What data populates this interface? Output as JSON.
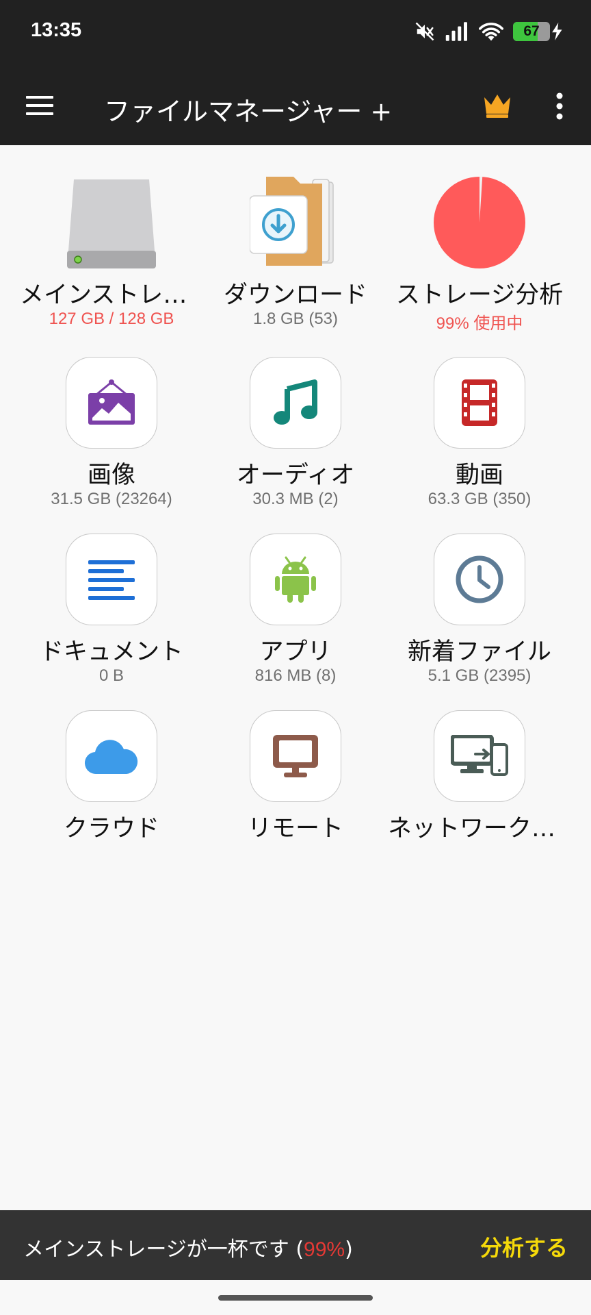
{
  "status_bar": {
    "time": "13:35",
    "battery_level": "67",
    "battery_fraction": 0.67,
    "icons": [
      "mute-icon",
      "signal-icon",
      "wifi-icon",
      "battery-icon",
      "charging-icon"
    ]
  },
  "app_bar": {
    "title": "ファイルマネージャー +",
    "icons": [
      "menu-icon",
      "crown-icon",
      "more-vert-icon"
    ]
  },
  "tiles": [
    {
      "label": "メインストレージ",
      "sub": "127 GB / 128 GB",
      "icon": "drive-icon",
      "sub_color": "#ef5350"
    },
    {
      "label": "ダウンロード",
      "sub": "1.8 GB (53)",
      "icon": "download-folder-icon"
    },
    {
      "label": "ストレージ分析",
      "sub": "99% 使用中",
      "icon": "pie-chart-icon",
      "sub_color": "#ef5350",
      "usage_fraction": 0.99
    },
    {
      "label": "画像",
      "sub": "31.5 GB (23264)",
      "icon": "image-icon"
    },
    {
      "label": "オーディオ",
      "sub": "30.3 MB (2)",
      "icon": "music-note-icon"
    },
    {
      "label": "動画",
      "sub": "63.3 GB (350)",
      "icon": "film-icon"
    },
    {
      "label": "ドキュメント",
      "sub": "0 B",
      "icon": "document-icon"
    },
    {
      "label": "アプリ",
      "sub": "816 MB (8)",
      "icon": "android-icon"
    },
    {
      "label": "新着ファイル",
      "sub": "5.1 GB (2395)",
      "icon": "clock-icon"
    },
    {
      "label": "クラウド",
      "sub": "",
      "icon": "cloud-icon"
    },
    {
      "label": "リモート",
      "sub": "",
      "icon": "monitor-icon"
    },
    {
      "label": "ネットワークから",
      "sub": "",
      "icon": "network-devices-icon"
    }
  ],
  "bottom_banner": {
    "message_prefix": "メインストレージが一杯です (",
    "percent": "99%",
    "message_suffix": ")",
    "action": "分析する"
  },
  "colors": {
    "bar_background": "#212121",
    "warning_red": "#ef5350",
    "action_yellow": "#f5d90a",
    "crown": "#f6a623"
  }
}
